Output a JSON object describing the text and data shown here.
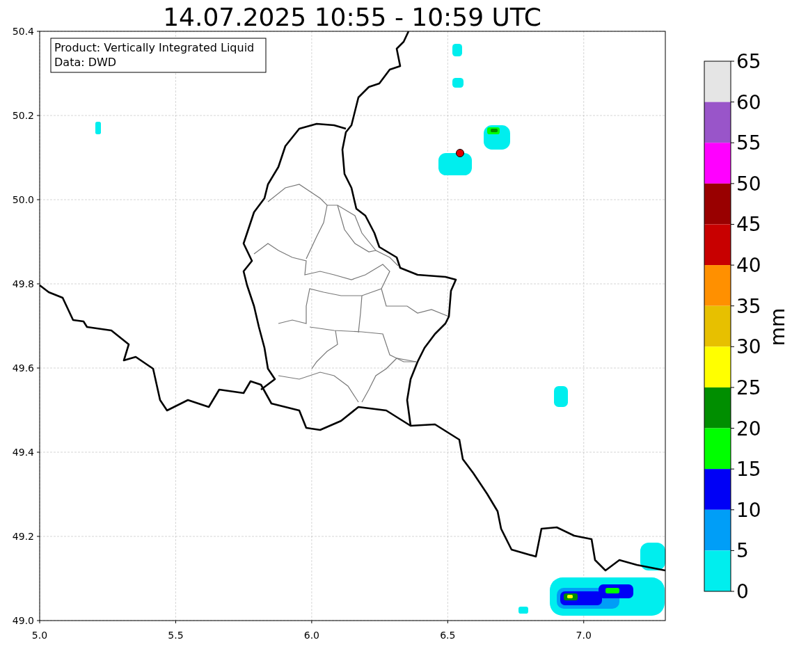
{
  "title": "14.07.2025 10:55 - 10:59 UTC",
  "info_box": [
    "Product: Vertically Integrated Liquid",
    "Data: DWD"
  ],
  "map": {
    "x_ticks": [
      "5.0",
      "5.5",
      "6.0",
      "6.5",
      "7.0"
    ],
    "y_ticks": [
      "50.4",
      "50.2",
      "50.0",
      "49.8",
      "49.6",
      "49.4",
      "49.2",
      "49.0"
    ]
  },
  "colorbar": {
    "label": "mm",
    "ticks": [
      "65",
      "60",
      "55",
      "50",
      "45",
      "40",
      "35",
      "30",
      "25",
      "20",
      "15",
      "10",
      "5",
      "0"
    ],
    "bands": [
      {
        "color": "#e5e5e5"
      },
      {
        "color": "#9955c9"
      },
      {
        "color": "#ff00ff"
      },
      {
        "color": "#990000"
      },
      {
        "color": "#c80000"
      },
      {
        "color": "#ff9000"
      },
      {
        "color": "#e7c000"
      },
      {
        "color": "#ffff00"
      },
      {
        "color": "#008e00"
      },
      {
        "color": "#00ff00"
      },
      {
        "color": "#0000f6"
      },
      {
        "color": "#009ef7"
      },
      {
        "color": "#00eeee"
      }
    ]
  }
}
